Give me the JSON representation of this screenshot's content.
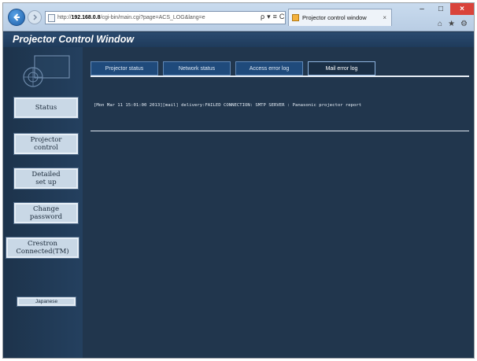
{
  "browser": {
    "url_prefix": "http://",
    "url_host": "192.168.0.8",
    "url_path": "/cgi-bin/main.cgi?page=ACS_LOG&lang=e",
    "address_tools": [
      "ρ",
      "▾",
      "≡",
      "C"
    ],
    "tab_title": "Projector control window",
    "tab_close": "×",
    "window_controls": {
      "minimize": "–",
      "maximize": "□",
      "close": "×"
    },
    "toolbar_icons": [
      "⌂",
      "★",
      "⚙"
    ]
  },
  "app": {
    "title": "Projector Control Window"
  },
  "sidebar": {
    "buttons": [
      {
        "label": "Status"
      },
      {
        "label": "Projector\ncontrol"
      },
      {
        "label": "Detailed\nset up"
      },
      {
        "label": "Change\npassword"
      },
      {
        "label": "Crestron\nConnected(TM)"
      }
    ],
    "language_button": "Japanese"
  },
  "tabs": [
    {
      "label": "Projector status",
      "active": false
    },
    {
      "label": "Network status",
      "active": false
    },
    {
      "label": "Access error log",
      "active": false
    },
    {
      "label": "Mail error log",
      "active": true
    }
  ],
  "log": {
    "entries": [
      "[Mon Mar 11 15:01:00 2013][mail] delivery:FAILED CONNECTION: SMTP SERVER : Panasonic projector report"
    ]
  },
  "colors": {
    "background": "#21364d",
    "header": "#1f3b5b",
    "tab": "#1f4a7b",
    "sidebar_button": "#c9d8e6"
  }
}
